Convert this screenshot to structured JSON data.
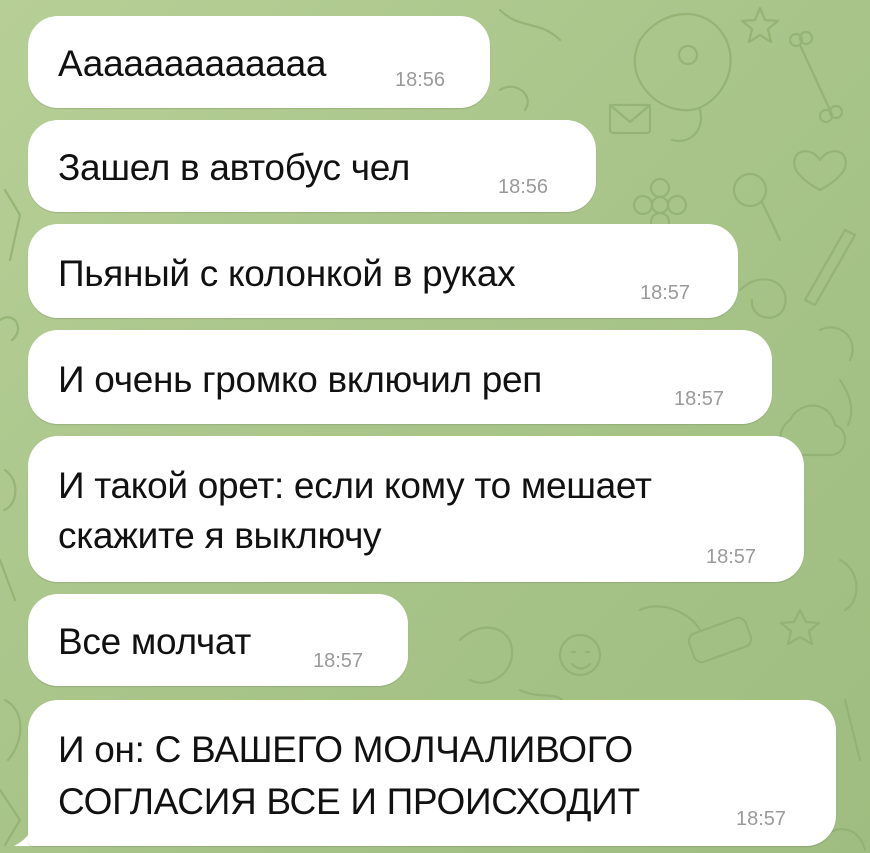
{
  "chat": {
    "wallpaper": "telegram-doodle-pattern",
    "colors": {
      "background": "#a9c58a",
      "bubble": "#ffffff",
      "text": "#111111",
      "time": "#9a9a9a"
    },
    "messages": [
      {
        "text": "Ааааааааааааа",
        "time": "18:56"
      },
      {
        "text": "Зашел в автобус чел",
        "time": "18:56"
      },
      {
        "text": "Пьяный с колонкой в руках",
        "time": "18:57"
      },
      {
        "text": "И очень громко включил реп",
        "time": "18:57"
      },
      {
        "lines": [
          "И такой орет: если кому то мешает",
          "скажите я выключу"
        ],
        "time": "18:57"
      },
      {
        "text": "Все молчат",
        "time": "18:57"
      },
      {
        "lines": [
          "И он: С ВАШЕГО МОЛЧАЛИВОГО",
          "СОГЛАСИЯ ВСЕ И ПРОИСХОДИТ"
        ],
        "time": "18:57"
      }
    ]
  }
}
